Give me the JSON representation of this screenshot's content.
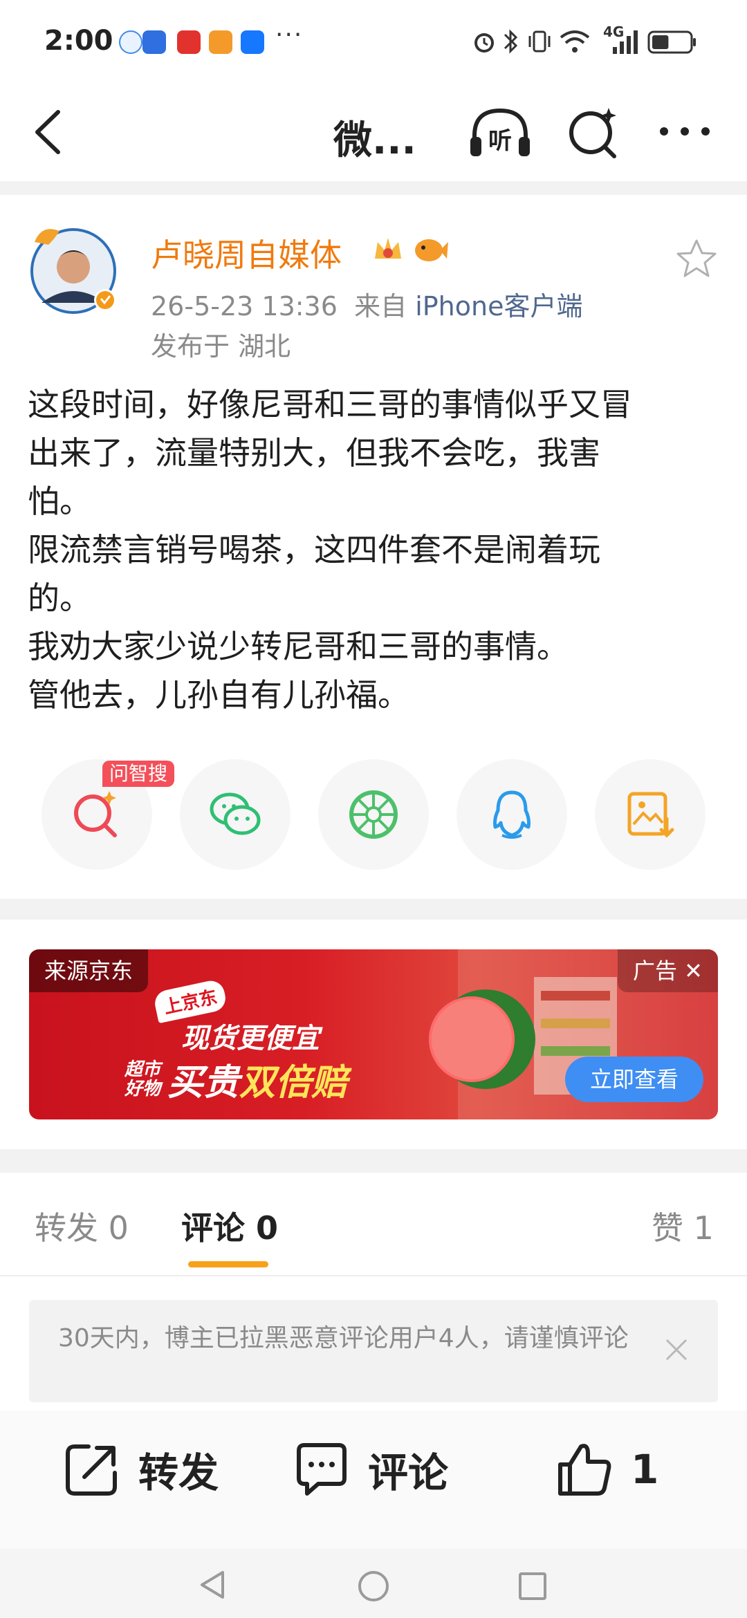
{
  "status_bar": {
    "time": "2:00",
    "dots": "···",
    "network": "4G",
    "battery_level": 0.45
  },
  "nav": {
    "title": "微...",
    "listen_label": "听"
  },
  "post": {
    "author": "卢晓周自媒体",
    "date": "26-5-23 13:36",
    "from_prefix": "来自",
    "client": "iPhone客户端",
    "location": "发布于 湖北",
    "lines": [
      "这段时间，好像尼哥和三哥的事情似乎又冒",
      "出来了，流量特别大，但我不会吃，我害",
      "怕。",
      "限流禁言销号喝茶，这四件套不是闹着玩",
      "的。",
      "我劝大家少说少转尼哥和三哥的事情。",
      "管他去，儿孙自有儿孙福。"
    ]
  },
  "share": {
    "ai_badge": "问智搜",
    "items": [
      "ai-search-icon",
      "wechat-icon",
      "moments-icon",
      "qq-icon",
      "save-image-icon"
    ]
  },
  "ad": {
    "source": "来源京东",
    "tag": "广告 ✕",
    "brand": "上京东",
    "slogan_line1": "现货更便宜",
    "slogan_small": "超市好物",
    "slogan_line2a": "买贵",
    "slogan_line2b": "双倍赔",
    "cta": "立即查看"
  },
  "tabs": {
    "repost": "转发 0",
    "comment": "评论 0",
    "like": "赞 1"
  },
  "notice": {
    "text": "30天内，博主已拉黑恶意评论用户4人，请谨慎评论"
  },
  "actions": {
    "repost": "转发",
    "comment": "评论",
    "like_count": "1"
  },
  "colors": {
    "accent": "#f7a11a",
    "author": "#f07a0e",
    "client_link": "#50688e",
    "ad_cta": "#3e8ef3"
  }
}
